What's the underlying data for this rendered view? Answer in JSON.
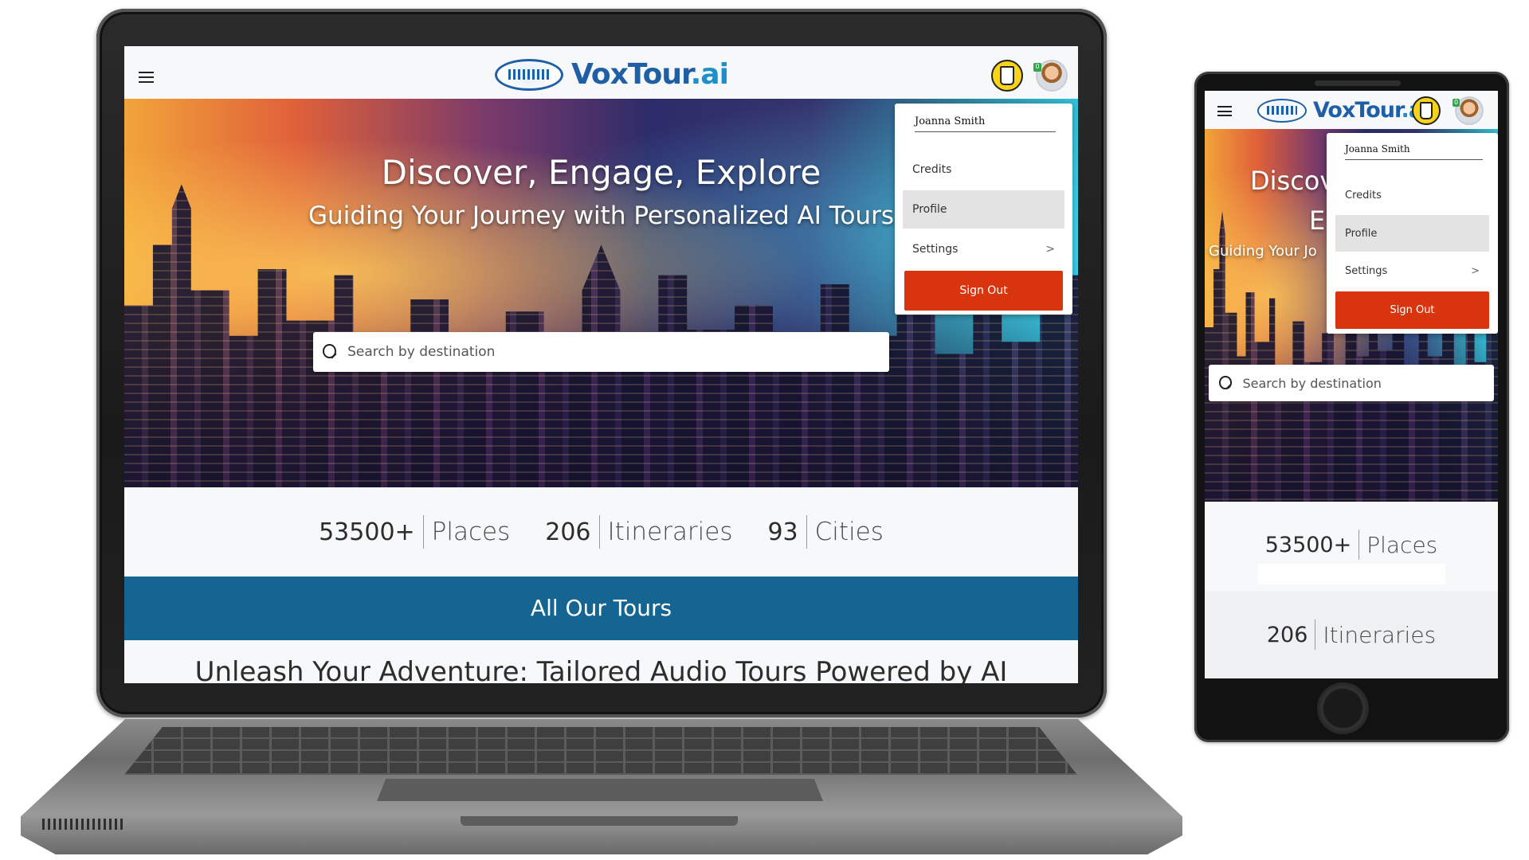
{
  "brand": {
    "name": "VoxTour",
    "suffix": ".ai"
  },
  "hero": {
    "title": "Discover, Engage, Explore",
    "subtitle": "Guiding Your Journey with Personalized AI Tours",
    "phone_title_line1": "Discov",
    "phone_title_line2": "E",
    "phone_subtitle": "Guiding Your Jo"
  },
  "search": {
    "placeholder": "Search by destination"
  },
  "stats": [
    {
      "value": "53500+",
      "label": "Places"
    },
    {
      "value": "206",
      "label": "Itineraries"
    },
    {
      "value": "93",
      "label": "Cities"
    }
  ],
  "tours_button": "All Our Tours",
  "tagline": "Unleash Your Adventure: Tailored Audio Tours Powered by AI",
  "user_menu": {
    "user_name": "Joanna Smith",
    "items": [
      {
        "label": "Credits",
        "active": false
      },
      {
        "label": "Profile",
        "active": true
      },
      {
        "label": "Settings",
        "active": false,
        "chevron": ">"
      }
    ],
    "sign_out": "Sign Out"
  },
  "icons": {
    "menu": "hamburger-icon",
    "search": "search-icon",
    "credits_cup": "coffee-cup-icon",
    "avatar": "user-avatar",
    "avatar_badge": "0"
  },
  "colors": {
    "brand_blue": "#1f5fa6",
    "tours_bar": "#156593",
    "sign_out": "#d8350f",
    "menu_active": "#e3e3e4"
  }
}
